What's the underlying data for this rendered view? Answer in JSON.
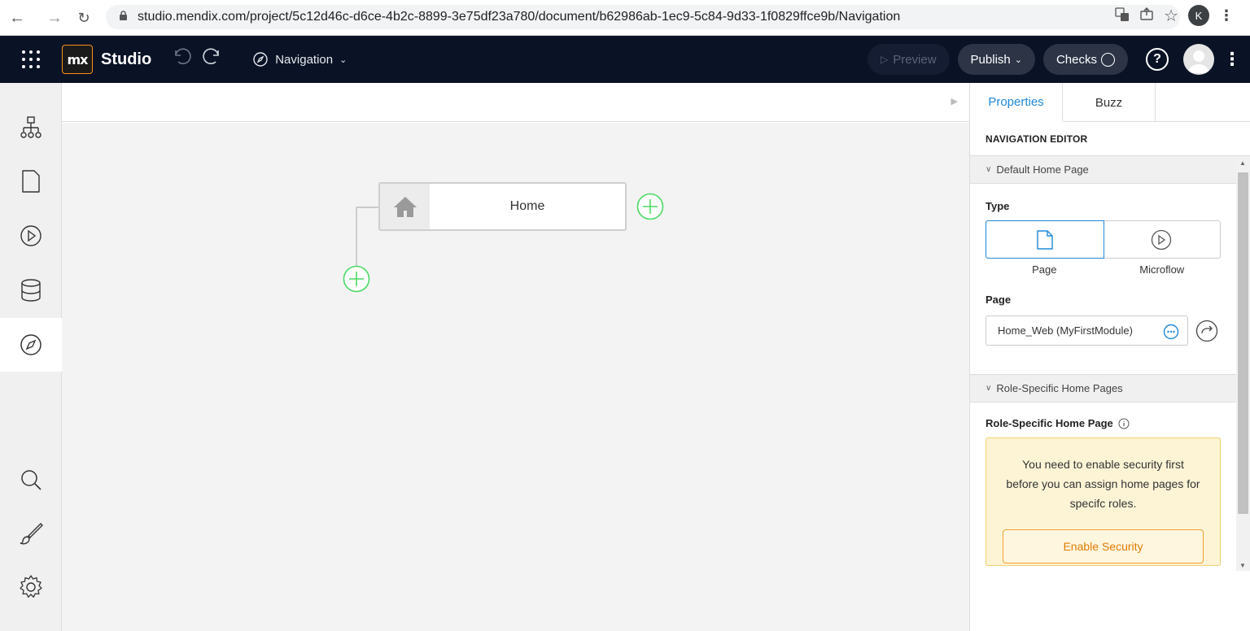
{
  "browser": {
    "url": "studio.mendix.com/project/5c12d46c-d6ce-4b2c-8899-3e75df23a780/document/b62986ab-1ec9-5c84-9d33-1f0829ffce9b/Navigation",
    "profile_initial": "K"
  },
  "header": {
    "logo_text": "mx",
    "app_title": "Studio",
    "document_name": "Navigation",
    "preview_label": "Preview",
    "publish_label": "Publish",
    "checks_label": "Checks",
    "help_label": "?"
  },
  "canvas": {
    "home_node_label": "Home"
  },
  "panel": {
    "tabs": [
      "Properties",
      "Buzz"
    ],
    "section_title": "NAVIGATION EDITOR",
    "default_home": {
      "group_title": "Default Home Page",
      "type_label": "Type",
      "type_options": [
        "Page",
        "Microflow"
      ],
      "page_label": "Page",
      "page_value": "Home_Web (MyFirstModule)"
    },
    "role_specific": {
      "group_title": "Role-Specific Home Pages",
      "field_label": "Role-Specific Home Page",
      "warning_text": "You need to enable security first before you can assign home pages for specifc roles.",
      "enable_button": "Enable Security"
    }
  },
  "colors": {
    "header_bg": "#0a1325",
    "accent_blue": "#1e88d8",
    "add_green": "#4cd964",
    "warning_bg": "#fdf4d6",
    "warning_button_text": "#e07b00"
  }
}
